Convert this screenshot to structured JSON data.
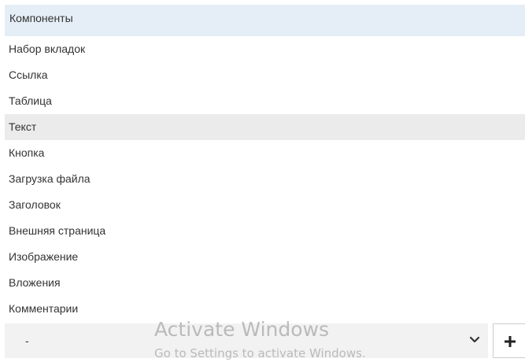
{
  "components": {
    "header": "Компоненты",
    "items": [
      {
        "label": "Набор вкладок"
      },
      {
        "label": "Ссылка"
      },
      {
        "label": "Таблица"
      },
      {
        "label": "Текст",
        "hovered": true
      },
      {
        "label": "Кнопка"
      },
      {
        "label": "Загрузка файла"
      },
      {
        "label": "Заголовок"
      },
      {
        "label": "Внешняя страница"
      },
      {
        "label": "Изображение"
      },
      {
        "label": "Вложения"
      },
      {
        "label": "Комментарии"
      }
    ]
  },
  "select": {
    "value": "-",
    "chevron_icon": "chevron-down-icon"
  },
  "add_button": {
    "icon": "plus-icon"
  },
  "watermark": {
    "title": "Activate Windows",
    "subtitle": "Go to Settings to activate Windows."
  },
  "colors": {
    "header_bg": "#e5eef6",
    "hover_bg": "#ebebeb",
    "select_bg": "#f2f2f2"
  }
}
